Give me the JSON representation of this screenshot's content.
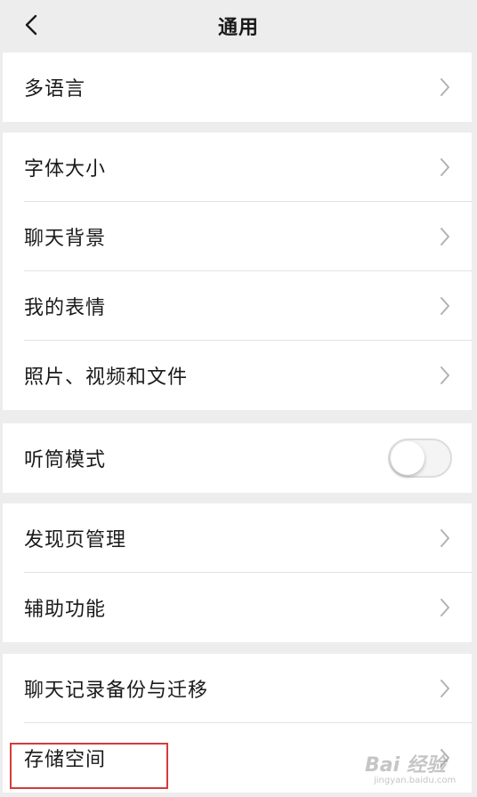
{
  "header": {
    "title": "通用",
    "back_icon": "chevron-left-icon"
  },
  "groups": [
    {
      "items": [
        {
          "label": "多语言",
          "type": "nav"
        }
      ]
    },
    {
      "items": [
        {
          "label": "字体大小",
          "type": "nav"
        },
        {
          "label": "聊天背景",
          "type": "nav"
        },
        {
          "label": "我的表情",
          "type": "nav"
        },
        {
          "label": "照片、视频和文件",
          "type": "nav"
        }
      ]
    },
    {
      "items": [
        {
          "label": "听筒模式",
          "type": "toggle",
          "toggle_on": false
        }
      ]
    },
    {
      "items": [
        {
          "label": "发现页管理",
          "type": "nav"
        },
        {
          "label": "辅助功能",
          "type": "nav"
        }
      ]
    },
    {
      "items": [
        {
          "label": "聊天记录备份与迁移",
          "type": "nav"
        },
        {
          "label": "存储空间",
          "type": "nav"
        }
      ]
    }
  ],
  "watermark": {
    "main": "Bai 经验",
    "sub": "jingyan.baidu.com"
  },
  "colors": {
    "background": "#ededed",
    "card": "#ffffff",
    "chevron": "#b2b2b2",
    "highlight": "#d43b3b"
  }
}
